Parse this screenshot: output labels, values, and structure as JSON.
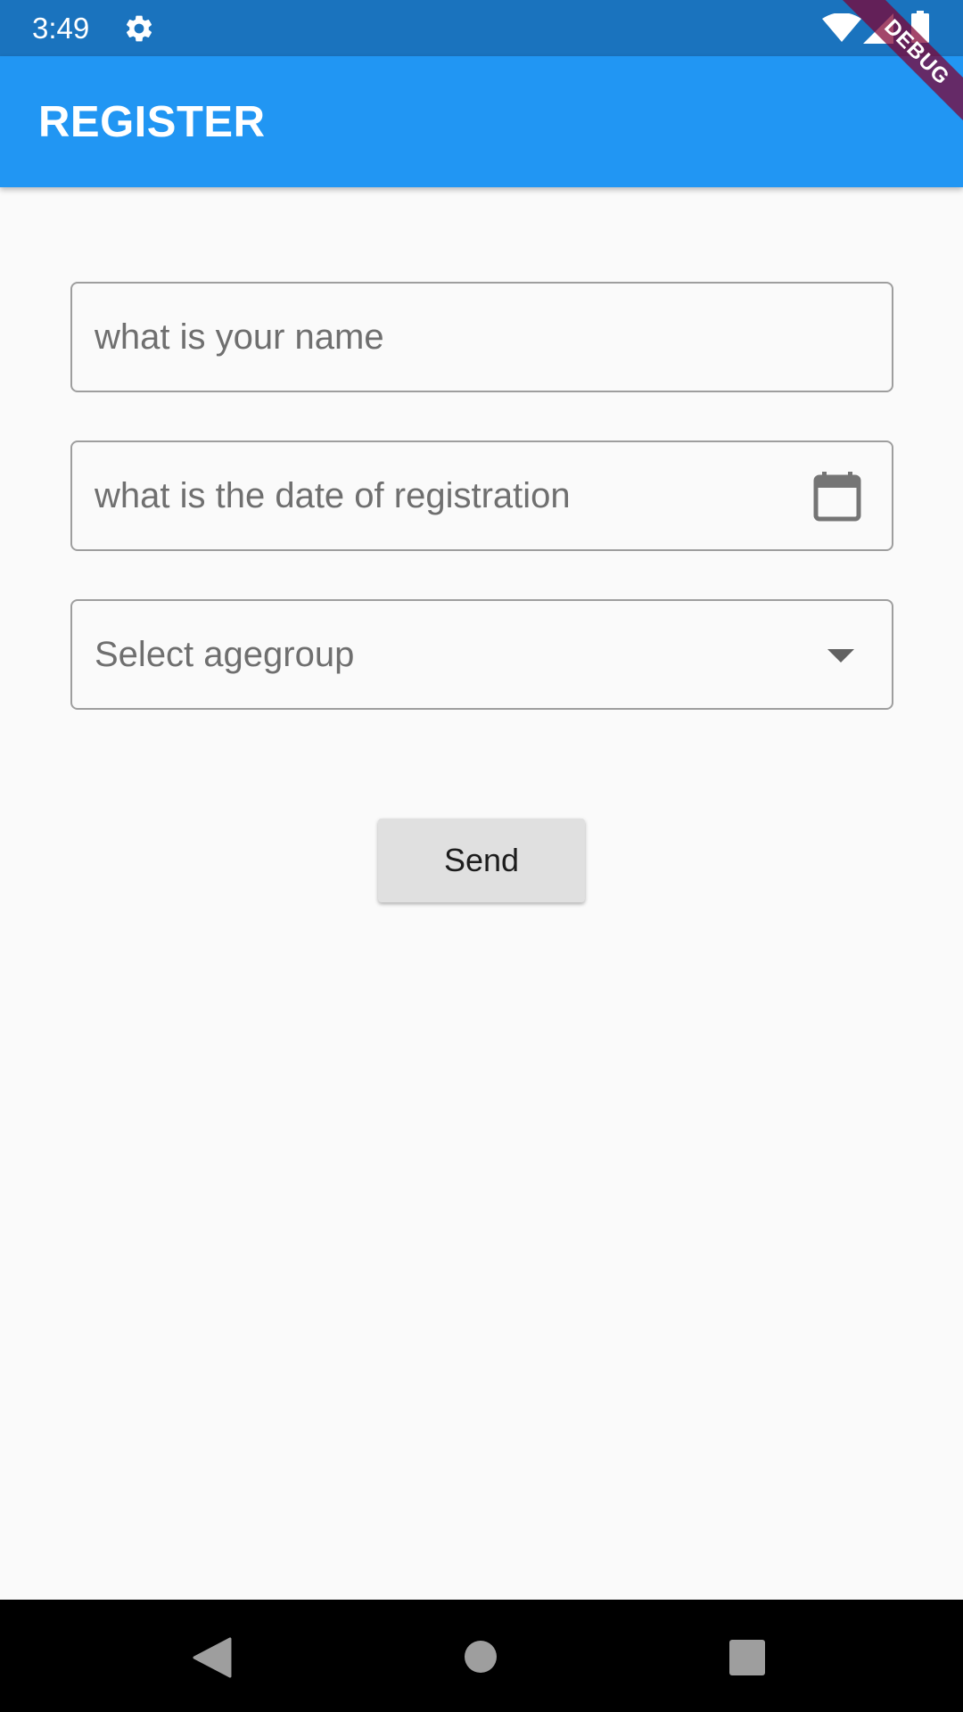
{
  "status_bar": {
    "time": "3:49",
    "icons": [
      "gear-icon",
      "wifi-icon",
      "cell-signal-icon",
      "battery-icon"
    ]
  },
  "debug_banner": {
    "label": "DEBUG"
  },
  "app_bar": {
    "title": "REGISTER",
    "color": "#2196f3"
  },
  "form": {
    "name_field": {
      "placeholder": "what is your name",
      "value": ""
    },
    "date_field": {
      "placeholder": "what is the date of registration",
      "value": "",
      "icon": "calendar-icon"
    },
    "agegroup_dropdown": {
      "placeholder": "Select agegroup",
      "icon": "arrow-drop-down-icon"
    },
    "send_button": {
      "label": "Send"
    }
  },
  "nav_bar": {
    "icons": [
      "back-icon",
      "home-icon",
      "recents-icon"
    ]
  }
}
